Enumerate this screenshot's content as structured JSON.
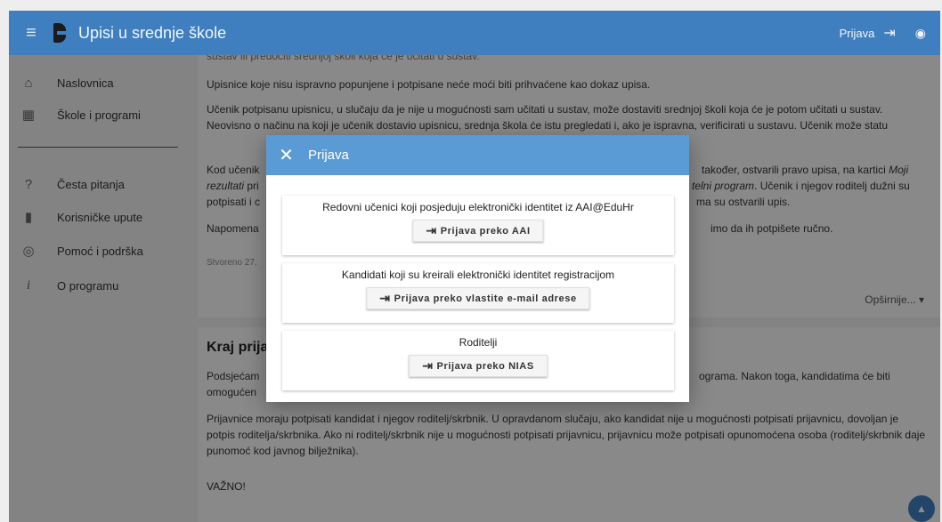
{
  "header": {
    "menu_icon": "hamburger-icon",
    "title": "Upisi u srednje škole",
    "login_label": "Prijava",
    "login_icon": "login-icon",
    "visibility_icon": "eye-icon"
  },
  "sidebar": {
    "items": [
      {
        "icon": "⌂",
        "label": "Naslovnica"
      },
      {
        "icon": "▦",
        "label": "Škole i programi"
      },
      {
        "icon": "?",
        "label": "Česta pitanja"
      },
      {
        "icon": "▮",
        "label": "Korisničke upute"
      },
      {
        "icon": "◎",
        "label": "Pomoć i podrška"
      },
      {
        "icon": "i",
        "label": "O programu"
      }
    ]
  },
  "card1": {
    "top_cut": "sustav ili predočiti srednjoj školi koja će je učitati u sustav.",
    "p1": "Upisnice koje nisu ispravno popunjene i potpisane neće moći biti prihvaćene kao dokaz upisa.",
    "p2": "Učenik potpisanu upisnicu, u slučaju da je nije u mogućnosti sam učitati u sustav, može dostaviti srednjoj školi koja će je potom učitati u sustav. Neovisno o načinu na koji je učenik dostavio upisnicu, srednja škola će istu pregledati i, ako je ispravna, verificirati u sustavu. Učenik može statu",
    "p3_start": "Kod učenik",
    "p3_end_a": "također, ostvarili pravo upisa, na kartici",
    "p3_italic": "Moji",
    "p3_line2_start": "rezultati",
    "p3_line2_mid": "pri",
    "p3_line2_italic": "telni program",
    "p3_line2_end": ". Učenik i njegov roditelj dužni su",
    "p3_line3_start": "potpisati i c",
    "p3_line3_end": "ma su ostvarili upis.",
    "p4_start": "Napomena",
    "p4_end": "imo da ih potpišete ručno.",
    "created": "Stvoreno 27.",
    "more": "Opširnije... ▾"
  },
  "card2": {
    "title": "Kraj prija",
    "p1_start": "Podsjećam",
    "p1_end": "ograma. Nakon toga, kandidatima će biti",
    "p1_line2": "omogućen",
    "p2": "Prijavnice moraju potpisati kandidat i njegov roditelj/skrbnik. U opravdanom slučaju, ako kandidat nije u mogućnosti potpisati prijavnicu, dovoljan je potpis roditelja/skrbnika. Ako ni roditelj/skrbnik nije u mogućnosti potpisati prijavnicu, prijavnicu može potpisati opunomoćena osoba (roditelj/skrbnik daje punomoć kod javnog bilježnika).",
    "p3": "VAŽNO!",
    "fab_icon": "chevron-up-icon"
  },
  "dialog": {
    "title": "Prijava",
    "close_icon": "close-icon",
    "options": [
      {
        "text": "Redovni učenici koji posjeduju elektronički identitet iz AAI@EduHr",
        "button": "Prijava preko AAI"
      },
      {
        "text": "Kandidati koji su kreirali elektronički identitet registracijom",
        "button": "Prijava preko vlastite e-mail adrese"
      },
      {
        "text": "Roditelji",
        "button": "Prijava preko NIAS"
      }
    ]
  }
}
